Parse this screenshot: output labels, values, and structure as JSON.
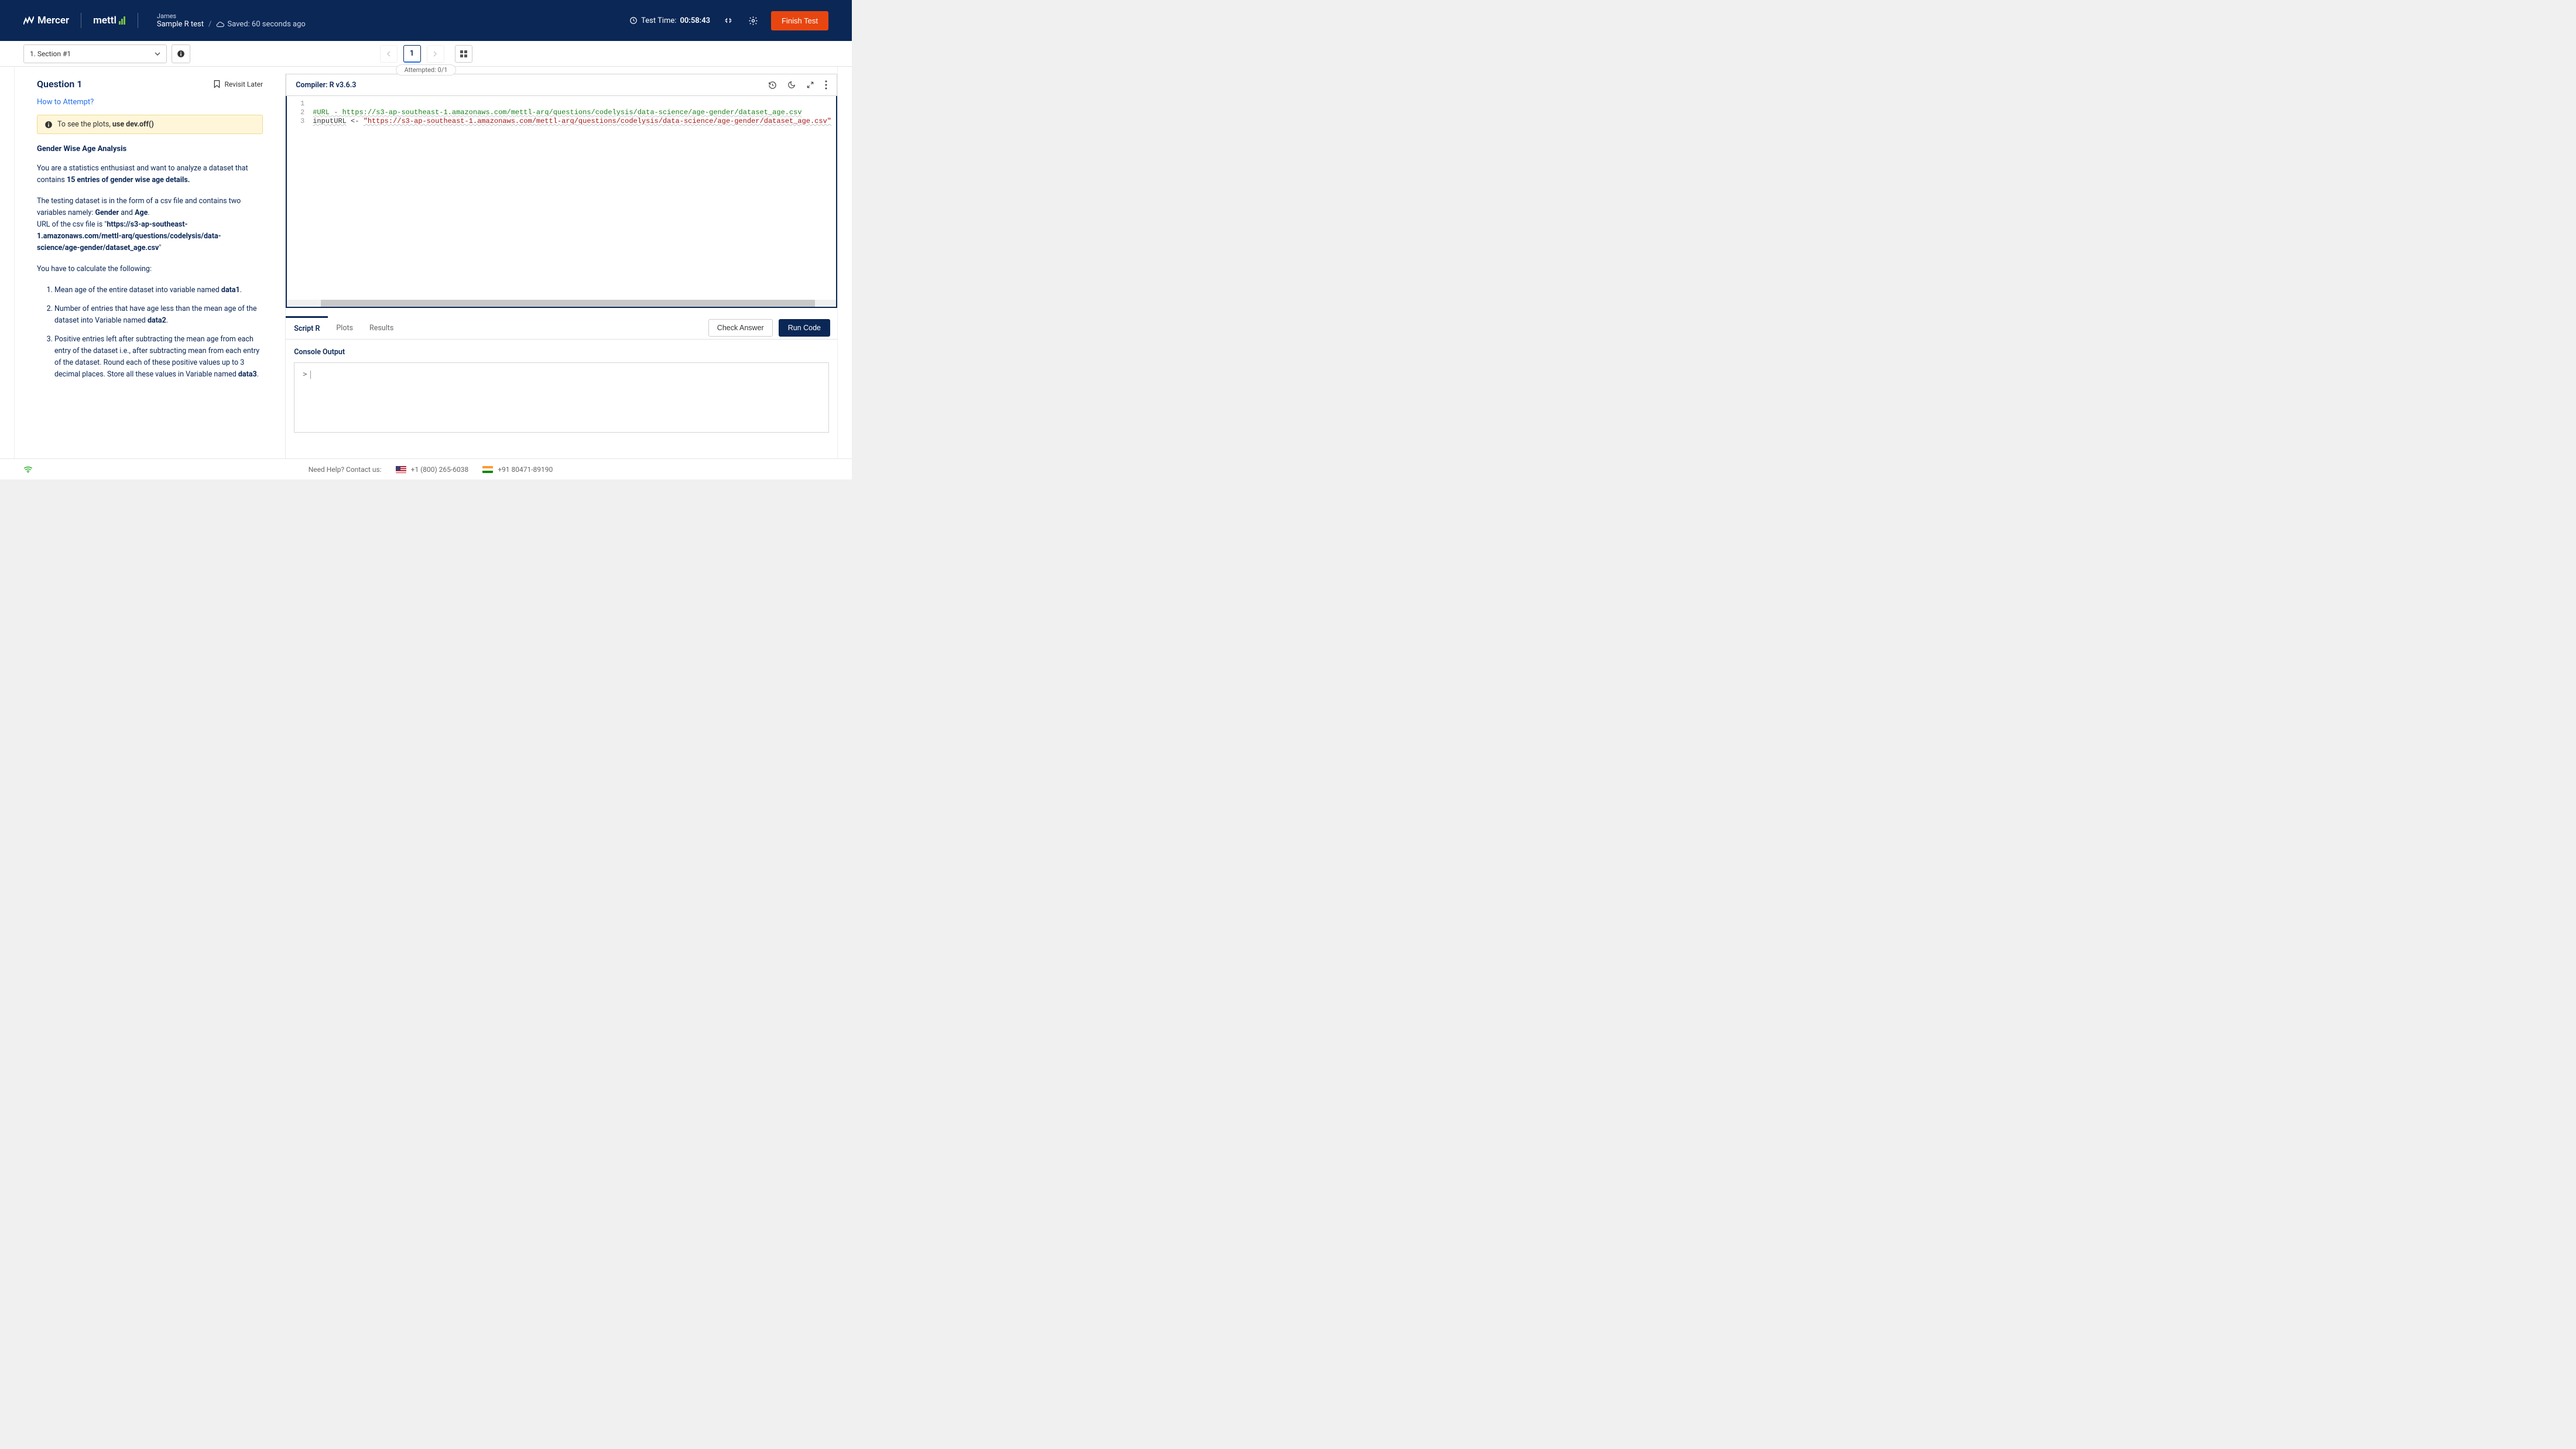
{
  "header": {
    "brand1": "Mercer",
    "brand2": "mettl",
    "user": "James",
    "test_name": "Sample R test",
    "saved_text": "Saved: 60 seconds ago",
    "time_label": "Test Time:",
    "time_value": "00:58:43",
    "finish_label": "Finish Test"
  },
  "toolbar": {
    "section_label": "1. Section #1",
    "current_page": "1",
    "attempted": "Attempted: 0/1"
  },
  "question": {
    "title": "Question 1",
    "revisit": "Revisit Later",
    "how_to": "How to Attempt?",
    "hint_prefix": "To see the plots,",
    "hint_bold": "use dev.off()",
    "heading": "Gender Wise Age Analysis",
    "p1_a": "You are a statistics enthusiast and want to analyze a dataset that contains ",
    "p1_b": "15 entries of gender wise age details.",
    "p2_a": "The testing dataset is in the form of a csv file and contains two variables namely: ",
    "p2_gender": "Gender",
    "p2_and": " and ",
    "p2_age": "Age",
    "p2_url_a": "URL of the csv file is \"",
    "p2_url_b": "https://s3-ap-southeast-1.amazonaws.com/mettl-arq/questions/codelysis/data-science/age-gender/dataset_age.csv",
    "p2_url_c": "\"",
    "p3": "You have to calculate the following:",
    "li1_a": "Mean age of the entire dataset into variable named ",
    "li1_b": "data1",
    "li2_a": "Number of entries that have age less than the mean age of the dataset into Variable named ",
    "li2_b": "data2",
    "li3_a": "Positive entries left after subtracting the mean age from each entry of the dataset i.e., after subtracting mean from each entry of the dataset. Round each of these positive values up to 3 decimal places. Store all these values in Variable named ",
    "li3_b": "data3"
  },
  "editor": {
    "compiler": "Compiler: R v3.6.3",
    "lines": {
      "l1_comment": "#URL - https://s3-ap-southeast-1.amazonaws.com/mettl-arq/questions/codelysis/data-science/age-gender/dataset_age.csv",
      "l2_ident": "inputURL",
      "l2_op": " <- ",
      "l2_str": "\"https://s3-ap-southeast-1.amazonaws.com/mettl-arq/questions/codelysis/data-science/age-gender/dataset_age.csv\""
    }
  },
  "output": {
    "tab_script": "Script R",
    "tab_plots": "Plots",
    "tab_results": "Results",
    "check_answer": "Check Answer",
    "run_code": "Run Code",
    "console_title": "Console Output",
    "prompt": ">"
  },
  "footer": {
    "help": "Need Help? Contact us:",
    "phone_us": "+1 (800) 265-6038",
    "phone_in": "+91 80471-89190"
  }
}
